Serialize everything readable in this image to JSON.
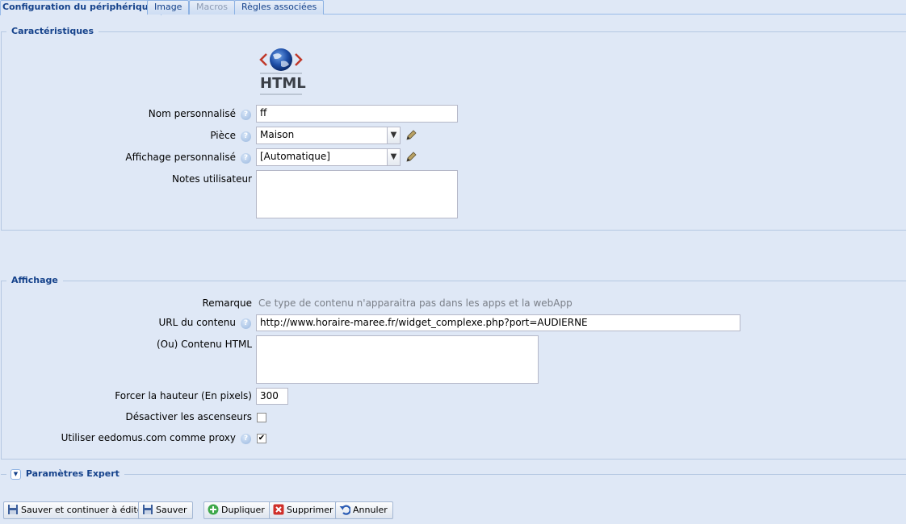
{
  "tabs": [
    {
      "label": "Configuration du périphérique",
      "state": "active"
    },
    {
      "label": "Image",
      "state": "normal"
    },
    {
      "label": "Macros",
      "state": "disabled"
    },
    {
      "label": "Règles associées",
      "state": "normal"
    }
  ],
  "characteristics": {
    "legend": "Caractéristiques",
    "logo_text": "HTML",
    "custom_name_label": "Nom personnalisé",
    "custom_name_value": "ff",
    "room_label": "Pièce",
    "room_value": "Maison",
    "display_label": "Affichage personnalisé",
    "display_value": "[Automatique]",
    "notes_label": "Notes utilisateur",
    "notes_value": ""
  },
  "affichage": {
    "legend": "Affichage",
    "remark_label": "Remarque",
    "remark_text": "Ce type de contenu n'apparaitra pas dans les apps et la webApp",
    "url_label": "URL du contenu",
    "url_value": "http://www.horaire-maree.fr/widget_complexe.php?port=AUDIERNE",
    "html_label": "(Ou) Contenu HTML",
    "html_value": "",
    "height_label": "Forcer la hauteur (En pixels)",
    "height_value": "300",
    "scroll_label": "Désactiver les ascenseurs",
    "scroll_checked": false,
    "proxy_label": "Utiliser eedomus.com comme proxy",
    "proxy_checked": true
  },
  "expert": {
    "legend": "Paramètres Expert"
  },
  "buttons": {
    "save_continue": "Sauver et continuer à éditer",
    "save": "Sauver",
    "duplicate": "Dupliquer",
    "delete": "Supprimer",
    "cancel": "Annuler"
  },
  "icons": {
    "help": "help-icon",
    "pencil": "pencil-icon",
    "dropdown": "chevron-down-icon",
    "logo": "html-globe-icon"
  },
  "colors": {
    "background": "#dfe8f6",
    "legend": "#15428b",
    "border": "#b5c8e2"
  }
}
